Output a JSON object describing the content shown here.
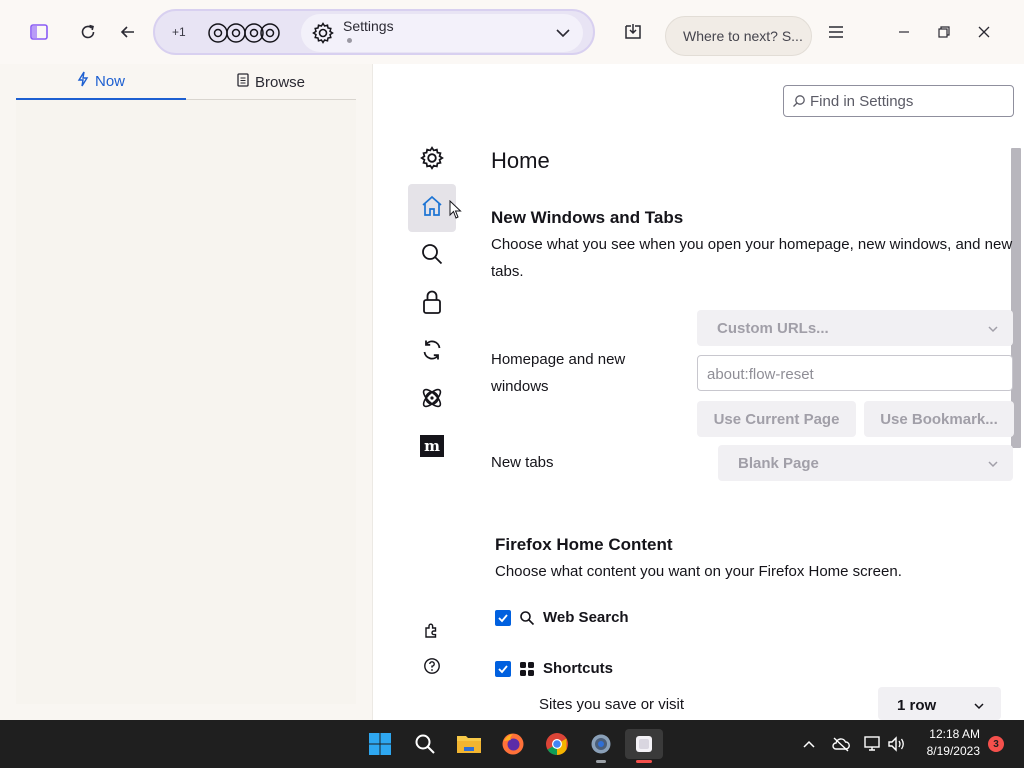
{
  "toolbar": {
    "tab_count": "+1",
    "active_tab_title": "Settings",
    "url_placeholder": "Where to next? S..."
  },
  "sidebar": {
    "tabs": [
      {
        "label": "Now",
        "icon": "lightning-icon",
        "active": true
      },
      {
        "label": "Browse",
        "icon": "document-icon",
        "active": false
      }
    ]
  },
  "settings": {
    "find_placeholder": "Find in Settings",
    "categories": [
      {
        "name": "general",
        "icon": "gear-icon"
      },
      {
        "name": "home",
        "icon": "home-icon",
        "selected": true
      },
      {
        "name": "search",
        "icon": "search-icon"
      },
      {
        "name": "privacy",
        "icon": "lock-icon"
      },
      {
        "name": "sync",
        "icon": "sync-icon"
      },
      {
        "name": "experiments",
        "icon": "atom-icon"
      },
      {
        "name": "more-from-mozilla",
        "icon": "mozilla-m-icon"
      }
    ],
    "page_title": "Home",
    "new_windows_tabs": {
      "heading": "New Windows and Tabs",
      "description": "Choose what you see when you open your homepage, new windows, and new tabs.",
      "homepage_label": "Homepage and new windows",
      "homepage_mode": "Custom URLs...",
      "homepage_url": "about:flow-reset",
      "use_current_page": "Use Current Page",
      "use_bookmark": "Use Bookmark...",
      "new_tabs_label": "New tabs",
      "new_tabs_value": "Blank Page"
    },
    "home_content": {
      "heading": "Firefox Home Content",
      "description": "Choose what content you want on your Firefox Home screen.",
      "web_search_label": "Web Search",
      "web_search_checked": true,
      "shortcuts_label": "Shortcuts",
      "shortcuts_checked": true,
      "shortcuts_sub": "Sites you save or visit",
      "rows_value": "1 row"
    }
  },
  "taskbar": {
    "time": "12:18 AM",
    "date": "8/19/2023",
    "notifications": "3",
    "apps": [
      "windows-start-icon",
      "search-icon",
      "file-explorer-icon",
      "firefox-icon",
      "chrome-icon",
      "settings-gear-icon",
      "app-icon"
    ]
  },
  "colors": {
    "accent": "#0060df",
    "selected_category": "#1d74d4",
    "taskbar_bg": "#1f1f1f"
  }
}
